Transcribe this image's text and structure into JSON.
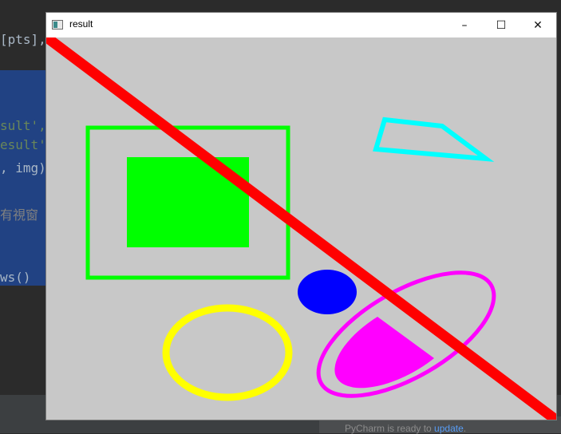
{
  "ide": {
    "code_lines": [
      "[pts],",
      "sult',",
      "esult'",
      ", img)",
      "有視窗",
      "ws()"
    ],
    "status": {
      "prefix": "PyCharm is ready to ",
      "link": "update",
      "suffix": "."
    }
  },
  "window": {
    "title": "result",
    "buttons": {
      "minimize": "–",
      "maximize": "☐",
      "close": "✕"
    }
  },
  "colors": {
    "canvas_bg": "#c8c8c8",
    "red": "#ff0000",
    "green": "#00ff00",
    "cyan": "#00ffff",
    "blue": "#0000ff",
    "magenta": "#ff00ff",
    "yellow": "#ffff00"
  }
}
